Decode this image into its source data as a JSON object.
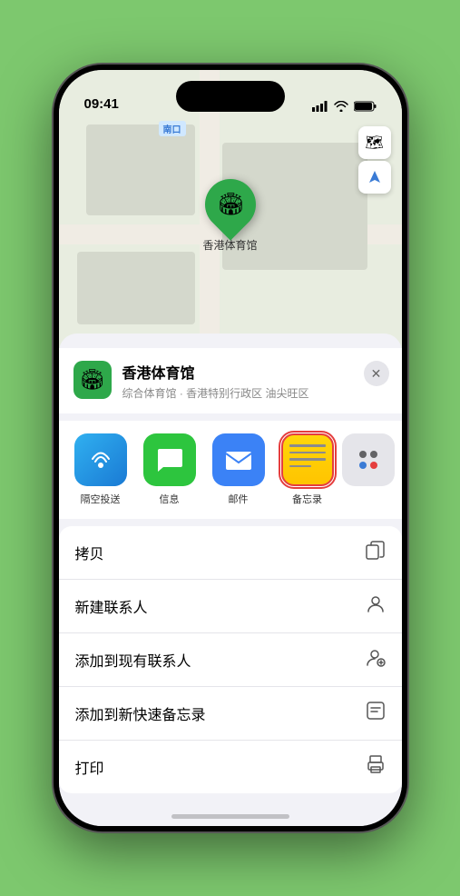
{
  "status": {
    "time": "09:41",
    "location_arrow": "▶",
    "signal": "●●●●",
    "wifi": "wifi",
    "battery": "battery"
  },
  "map": {
    "south_entrance_label": "南口"
  },
  "venue": {
    "name": "香港体育馆",
    "subtitle": "综合体育馆 · 香港特别行政区 油尖旺区",
    "marker_label": "香港体育馆"
  },
  "share_items": [
    {
      "id": "airdrop",
      "label": "隔空投送",
      "type": "airdrop"
    },
    {
      "id": "messages",
      "label": "信息",
      "type": "messages"
    },
    {
      "id": "mail",
      "label": "邮件",
      "type": "mail"
    },
    {
      "id": "notes",
      "label": "备忘录",
      "type": "notes"
    }
  ],
  "actions": [
    {
      "id": "copy",
      "label": "拷贝",
      "icon": "📋"
    },
    {
      "id": "new-contact",
      "label": "新建联系人",
      "icon": "👤"
    },
    {
      "id": "add-contact",
      "label": "添加到现有联系人",
      "icon": "👤"
    },
    {
      "id": "add-notes",
      "label": "添加到新快速备忘录",
      "icon": "📝"
    },
    {
      "id": "print",
      "label": "打印",
      "icon": "🖨️"
    }
  ],
  "controls": {
    "map_icon": "🗺",
    "location_icon": "⬆"
  }
}
